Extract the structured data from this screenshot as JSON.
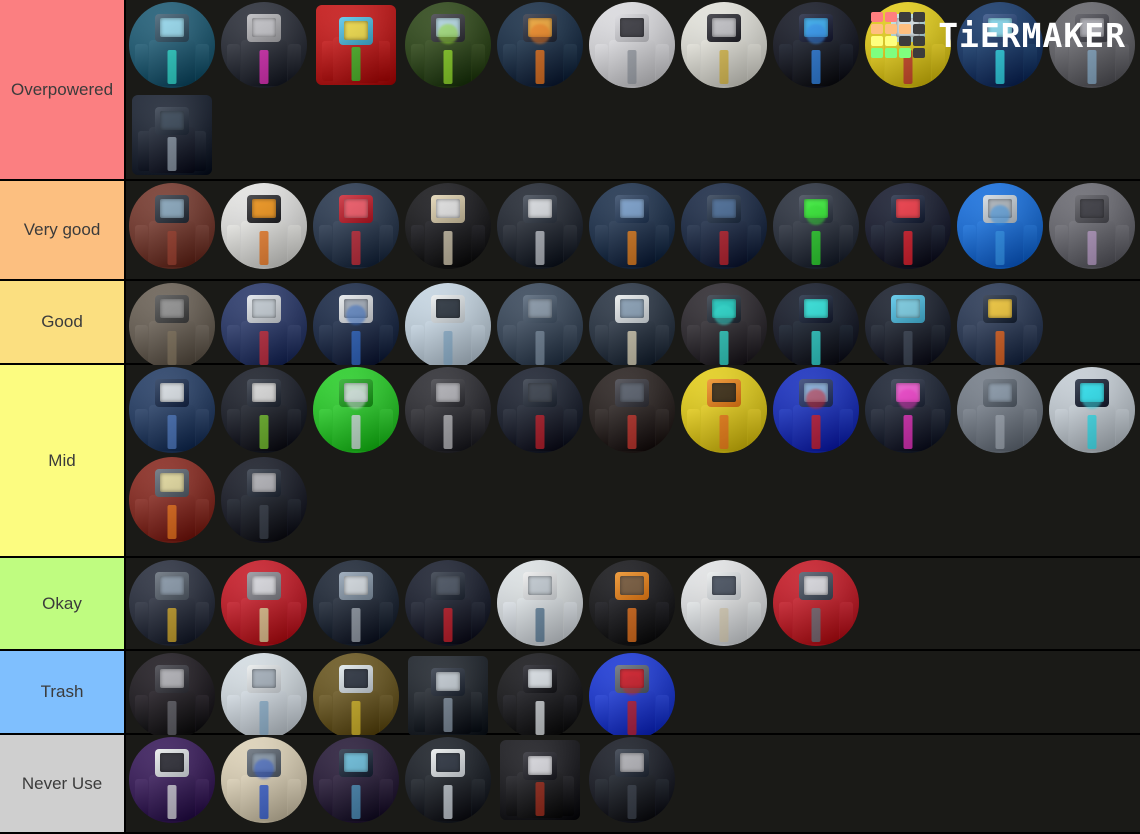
{
  "app": {
    "name": "TierMaker",
    "logo_text": "TiERMAKER",
    "logo_grid": [
      [
        "#ff7f7f",
        "#ff7f7f",
        "#3c3c3c",
        "#3c3c3c"
      ],
      [
        "#ffbf7f",
        "#ffbf7f",
        "#ffbf7f",
        "#3c3c3c"
      ],
      [
        "#ffff7f",
        "#ffff7f",
        "#3c3c3c",
        "#3c3c3c"
      ],
      [
        "#7fff7f",
        "#7fff7f",
        "#7fff7f",
        "#3c3c3c"
      ]
    ],
    "background": "#1a1a17"
  },
  "tiers": [
    {
      "label": "Overpowered",
      "color": "#fb7f81",
      "items": [
        {
          "name": "cyan-mech-camera-toilet",
          "body": "#1e5f7a",
          "accent": "#2ff0e0",
          "head": "#3a5a6e",
          "screen": "#9fe8ff",
          "shape": "circ",
          "variant": "mech"
        },
        {
          "name": "magenta-blade-tv-man",
          "body": "#2b2f3a",
          "accent": "#ff2fd0",
          "head": "#b8b8bc",
          "screen": "#cfcfd4",
          "shape": "circ",
          "variant": "blade"
        },
        {
          "name": "red-green-block-toilet",
          "body": "#cf1414",
          "accent": "#39d92b",
          "head": "#4fc3e8",
          "screen": "#ffe94a",
          "shape": "sq",
          "variant": "blocks"
        },
        {
          "name": "green-glow-cameraman",
          "body": "#2f4a16",
          "accent": "#9cf028",
          "head": "#3a3a42",
          "screen": "#bfe6f2",
          "shape": "circ",
          "variant": "glowgreen"
        },
        {
          "name": "orange-core-speakerman",
          "body": "#17304a",
          "accent": "#ff7a18",
          "head": "#2a3040",
          "screen": "#ffb03a",
          "shape": "circ",
          "variant": "core"
        },
        {
          "name": "white-suit-camera-titan",
          "body": "#e6e6ea",
          "accent": "#9fa4ae",
          "head": "#d8d8dd",
          "screen": "#3a3a42",
          "shape": "circ",
          "variant": "white"
        },
        {
          "name": "pizza-tv-man",
          "body": "#f0efe6",
          "accent": "#e8c341",
          "head": "#2b2b33",
          "screen": "#cfcfd4",
          "shape": "circ",
          "variant": "pizza"
        },
        {
          "name": "blue-eyes-titan-tv",
          "body": "#111726",
          "accent": "#2f8fff",
          "head": "#18203a",
          "screen": "#39b6ff",
          "shape": "circ",
          "variant": "blueeyes"
        },
        {
          "name": "yellow-rocket-toilet",
          "body": "#f2d81a",
          "accent": "#d2342b",
          "head": "#bfe8ee",
          "screen": "#e8f4f8",
          "shape": "circ",
          "variant": "yellow"
        },
        {
          "name": "blue-glow-spear-tv",
          "body": "#123a6e",
          "accent": "#2ff0ff",
          "head": "#2b4a80",
          "screen": "#8fe8ff",
          "shape": "circ",
          "variant": "spear"
        },
        {
          "name": "grey-mech-cameraman",
          "body": "#6a6a70",
          "accent": "#8fb8d8",
          "head": "#4a4a52",
          "screen": "#b8b8c0",
          "shape": "circ",
          "variant": "greymech"
        },
        {
          "name": "crt-tv-man-classic",
          "body": "#1b2434",
          "accent": "#9aa8b8",
          "head": "#2c3646",
          "screen": "#3a4a5c",
          "shape": "sq",
          "variant": "crt"
        }
      ]
    },
    {
      "label": "Very good",
      "color": "#fcbf80",
      "items": [
        {
          "name": "red-hat-sword-tv-man",
          "body": "#7a3a2e",
          "accent": "#a8412e",
          "head": "#2e3642",
          "screen": "#8fb0c8",
          "shape": "circ",
          "variant": "hat"
        },
        {
          "name": "traffic-light-toilet",
          "body": "#f2f2ee",
          "accent": "#ff7a18",
          "head": "#2a2a2e",
          "screen": "#ff9c18",
          "shape": "circ",
          "variant": "trafficlight"
        },
        {
          "name": "red-crystal-tv-man",
          "body": "#2a3a52",
          "accent": "#e02a3a",
          "head": "#c81e2c",
          "screen": "#ff5a6a",
          "shape": "circ",
          "variant": "crystal"
        },
        {
          "name": "suit-scientist-man",
          "body": "#16161c",
          "accent": "#e8dcc0",
          "head": "#e0d2b0",
          "screen": "#f0f0f0",
          "shape": "circ",
          "variant": "suitman"
        },
        {
          "name": "dotted-speaker-titan",
          "body": "#222833",
          "accent": "#cfd4dc",
          "head": "#39414e",
          "screen": "#e8ebf0",
          "shape": "circ",
          "variant": "dots"
        },
        {
          "name": "spiked-ball-cameraman",
          "body": "#1e3350",
          "accent": "#ff8a18",
          "head": "#2a4060",
          "screen": "#7fa8d8",
          "shape": "circ",
          "variant": "spike"
        },
        {
          "name": "red-horn-upgraded-titan",
          "body": "#1a2b48",
          "accent": "#d8202c",
          "head": "#28384f",
          "screen": "#4a6f9e",
          "shape": "circ",
          "variant": "horn"
        },
        {
          "name": "green-screen-laptop-man",
          "body": "#2b3240",
          "accent": "#2cf02c",
          "head": "#38404f",
          "screen": "#3cff3c",
          "shape": "circ",
          "variant": "greenscreen"
        },
        {
          "name": "red-dot-mech-titan",
          "body": "#141c30",
          "accent": "#ff1c2c",
          "head": "#1c2740",
          "screen": "#ff3a48",
          "shape": "circ",
          "variant": "reddot"
        },
        {
          "name": "blue-glow-tv-titan",
          "body": "#1474e8",
          "accent": "#2f9cff",
          "head": "#cfd8e0",
          "screen": "#b8c0c8",
          "shape": "circ",
          "variant": "bluetv"
        },
        {
          "name": "grey-speaker-jetpack",
          "body": "#6e6e76",
          "accent": "#c8a8d8",
          "head": "#55555c",
          "screen": "#3a3a42",
          "shape": "circ",
          "variant": "speaker"
        }
      ]
    },
    {
      "label": "Good",
      "color": "#fbdf80",
      "items": [
        {
          "name": "armored-camera-soldier",
          "body": "#6e6458",
          "accent": "#8a7a62",
          "head": "#4a4a4a",
          "screen": "#9a9a9a",
          "shape": "circ",
          "variant": "armor"
        },
        {
          "name": "candy-cane-tv-man",
          "body": "#2a3a6e",
          "accent": "#e02a3a",
          "head": "#dfe4ea",
          "screen": "#cfd8e0",
          "shape": "circ",
          "variant": "candy"
        },
        {
          "name": "blue-mech-cameraman",
          "body": "#1a2b4a",
          "accent": "#2f6fd8",
          "head": "#e4e8ee",
          "screen": "#aab4c2",
          "shape": "circ",
          "variant": "bluemech"
        },
        {
          "name": "white-tv-drone-man",
          "body": "#cfe0ee",
          "accent": "#8fb8d8",
          "head": "#e8f0f6",
          "screen": "#2a3440",
          "shape": "circ",
          "variant": "whitetv"
        },
        {
          "name": "large-speaker-titan",
          "body": "#3a4a5e",
          "accent": "#7f93a8",
          "head": "#4e5f73",
          "screen": "#8fa0b2",
          "shape": "circ",
          "variant": "bigspeaker"
        },
        {
          "name": "paper-hands-tv-man",
          "body": "#2a3646",
          "accent": "#f0e6c8",
          "head": "#e8f0f6",
          "screen": "#8fa8c0",
          "shape": "circ",
          "variant": "paper"
        },
        {
          "name": "cyan-heart-suit-man",
          "body": "#2e2a30",
          "accent": "#2ff0e0",
          "head": "#2a333f",
          "screen": "#1ed8cc",
          "shape": "circ",
          "variant": "cyanheart"
        },
        {
          "name": "cyan-tentacle-titan",
          "body": "#101a2a",
          "accent": "#2ff0e8",
          "head": "#16243a",
          "screen": "#2ff0e8",
          "shape": "circ",
          "variant": "tentacle"
        },
        {
          "name": "dark-blade-tv-man",
          "body": "#18202e",
          "accent": "#3f4a5c",
          "head": "#4fc3e8",
          "screen": "#7fd8f0",
          "shape": "circ",
          "variant": "darkblade"
        },
        {
          "name": "orange-flame-suit-man",
          "body": "#2a3a58",
          "accent": "#ff6a18",
          "head": "#1e2a3e",
          "screen": "#ffd23a",
          "shape": "circ",
          "variant": "flame"
        }
      ]
    },
    {
      "label": "Mid",
      "color": "#fcfc80",
      "items": [
        {
          "name": "blue-beast-cameraman",
          "body": "#26406a",
          "accent": "#4f7fcf",
          "head": "#1a2f52",
          "screen": "#e8eef4",
          "shape": "circ",
          "variant": "beast"
        },
        {
          "name": "green-pole-suit-man",
          "body": "#1a1f2a",
          "accent": "#7fd82c",
          "head": "#2a313e",
          "screen": "#e8e8e8",
          "shape": "circ",
          "variant": "pole"
        },
        {
          "name": "green-rocket-toilet",
          "body": "#2ad82a",
          "accent": "#e8f0f6",
          "head": "#1ea81e",
          "screen": "#cfefd8",
          "shape": "circ",
          "variant": "greenrocket"
        },
        {
          "name": "static-screen-titan",
          "body": "#2e2e34",
          "accent": "#c8c8cc",
          "head": "#3a3a40",
          "screen": "#bcbcc2",
          "shape": "circ",
          "variant": "static"
        },
        {
          "name": "red-stripe-cameraman",
          "body": "#1a2130",
          "accent": "#d01a28",
          "head": "#2a3240",
          "screen": "#39414e",
          "shape": "circ",
          "variant": "redstripe"
        },
        {
          "name": "red-wing-tv-man",
          "body": "#2a2220",
          "accent": "#d8342a",
          "head": "#3a3a42",
          "screen": "#5a6270",
          "shape": "circ",
          "variant": "wing"
        },
        {
          "name": "pumpkin-head-speaker",
          "body": "#f2d81a",
          "accent": "#ff7a18",
          "head": "#ff8a1a",
          "screen": "#3a2a10",
          "shape": "circ",
          "variant": "pumpkin"
        },
        {
          "name": "blue-red-tv-titan",
          "body": "#1430c8",
          "accent": "#e01a28",
          "head": "#2a3a6e",
          "screen": "#8fb8e8",
          "shape": "circ",
          "variant": "bluered"
        },
        {
          "name": "pink-glow-headphone-man",
          "body": "#1c2435",
          "accent": "#ff2fd0",
          "head": "#283044",
          "screen": "#ff5fe0",
          "shape": "circ",
          "variant": "pink"
        },
        {
          "name": "grey-lens-cameraman",
          "body": "#7a838f",
          "accent": "#aab4c0",
          "head": "#5e6874",
          "screen": "#8fa0b2",
          "shape": "circ",
          "variant": "greylens"
        },
        {
          "name": "cyan-core-titan",
          "body": "#cfd8e0",
          "accent": "#2ff0ff",
          "head": "#162236",
          "screen": "#2ff0ff",
          "shape": "circ",
          "variant": "cyancore"
        },
        {
          "name": "orange-red-suit-cameraman",
          "body": "#8e2a20",
          "accent": "#ff7a18",
          "head": "#5e6874",
          "screen": "#f2e8a8",
          "shape": "circ",
          "variant": "orangesuit"
        },
        {
          "name": "dark-static-tv-man",
          "body": "#161c28",
          "accent": "#39414e",
          "head": "#2a3240",
          "screen": "#bcbcc2",
          "shape": "circ",
          "variant": "darkstatic"
        }
      ]
    },
    {
      "label": "Okay",
      "color": "#bffc80",
      "items": [
        {
          "name": "gold-suit-cameraman",
          "body": "#2a3040",
          "accent": "#e8b828",
          "head": "#5e6874",
          "screen": "#8fa0b2",
          "shape": "circ",
          "variant": "gold"
        },
        {
          "name": "red-devil-speaker-man",
          "body": "#d01a28",
          "accent": "#f2e8a8",
          "head": "#8e8e96",
          "screen": "#e8e8ee",
          "shape": "circ",
          "variant": "devil"
        },
        {
          "name": "white-screen-suit-man",
          "body": "#1e2838",
          "accent": "#aab4c0",
          "head": "#8fa0b2",
          "screen": "#dfe6ec",
          "shape": "circ",
          "variant": "whitescreen"
        },
        {
          "name": "red-tie-cameraman",
          "body": "#1a2030",
          "accent": "#e01a28",
          "head": "#2a3240",
          "screen": "#4a5464",
          "shape": "circ",
          "variant": "redtie"
        },
        {
          "name": "white-coat-tv-man",
          "body": "#e8eef4",
          "accent": "#5a7f9e",
          "head": "#f0f4f8",
          "screen": "#cfd8e0",
          "shape": "circ",
          "variant": "whitecoat"
        },
        {
          "name": "pumpkin-cloak-man",
          "body": "#14141a",
          "accent": "#ff7a18",
          "head": "#ff8a1a",
          "screen": "#7a5a3a",
          "shape": "circ",
          "variant": "cloak"
        },
        {
          "name": "white-tv-woman",
          "body": "#f0f4f8",
          "accent": "#e8dcc0",
          "head": "#e8eef4",
          "screen": "#4a5464",
          "shape": "circ",
          "variant": "whitewoman"
        },
        {
          "name": "red-grey-speakerman",
          "body": "#d01a28",
          "accent": "#6e7882",
          "head": "#4a5464",
          "screen": "#e8e8ee",
          "shape": "circ",
          "variant": "redgrey"
        }
      ]
    },
    {
      "label": "Trash",
      "color": "#7fbffe",
      "items": [
        {
          "name": "static-tv-man-basic",
          "body": "#1e1820",
          "accent": "#6a6a72",
          "head": "#3a3a42",
          "screen": "#bcbcc2",
          "shape": "circ",
          "variant": "basicstatic"
        },
        {
          "name": "white-antenna-tv-man",
          "body": "#dfe8f0",
          "accent": "#8fb8d8",
          "head": "#e8eef4",
          "screen": "#b0bcc8",
          "shape": "circ",
          "variant": "antenna"
        },
        {
          "name": "yellow-tie-tv-man",
          "body": "#6e5a20",
          "accent": "#e8c828",
          "head": "#dfe8f0",
          "screen": "#2a3240",
          "shape": "circ",
          "variant": "yellowtie"
        },
        {
          "name": "box-speaker-man",
          "body": "#20262e",
          "accent": "#8fa0b2",
          "head": "#2a3240",
          "screen": "#cfd8e0",
          "shape": "sq",
          "variant": "boxspeaker"
        },
        {
          "name": "tall-speaker-toilet",
          "body": "#14141a",
          "accent": "#f0f4f8",
          "head": "#1a1a22",
          "screen": "#e8eef4",
          "shape": "circ",
          "variant": "tallspeaker"
        },
        {
          "name": "red-blue-cameraman",
          "body": "#1a3ae0",
          "accent": "#d01a28",
          "head": "#5e6874",
          "screen": "#e01a28",
          "shape": "circ",
          "variant": "redblue"
        }
      ]
    },
    {
      "label": "Never Use",
      "color": "#cfcfcf",
      "items": [
        {
          "name": "purple-robe-tv-man",
          "body": "#3a1a5e",
          "accent": "#e8e8f0",
          "head": "#e8eef4",
          "screen": "#2a2a34",
          "shape": "circ",
          "variant": "purple"
        },
        {
          "name": "white-blue-cameraman",
          "body": "#e8dcc0",
          "accent": "#2a5ae0",
          "head": "#5e6874",
          "screen": "#8fa0b2",
          "shape": "circ",
          "variant": "whiteblue"
        },
        {
          "name": "dark-gear-cloak-man",
          "body": "#281a3a",
          "accent": "#4f9fcf",
          "head": "#1e2a3e",
          "screen": "#6fc8e8",
          "shape": "circ",
          "variant": "gear"
        },
        {
          "name": "suit-tv-man-basic",
          "body": "#1a2028",
          "accent": "#dfe8f0",
          "head": "#e8eef4",
          "screen": "#2a3240",
          "shape": "circ",
          "variant": "suittv"
        },
        {
          "name": "red-box-speaker",
          "body": "#1a1a20",
          "accent": "#b02a18",
          "head": "#24242c",
          "screen": "#e8e8ee",
          "shape": "sq",
          "variant": "redbox"
        },
        {
          "name": "dark-static-toilet",
          "body": "#161c26",
          "accent": "#39414e",
          "head": "#2a3240",
          "screen": "#bcbcc2",
          "shape": "circ",
          "variant": "darktoilet"
        }
      ]
    }
  ]
}
